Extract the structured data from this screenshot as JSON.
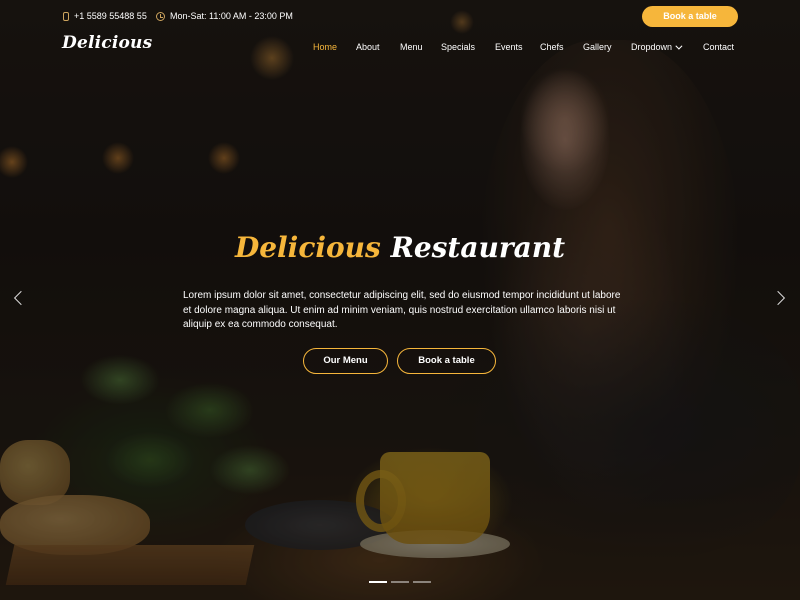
{
  "topbar": {
    "phone": "+1 5589 55488 55",
    "hours": "Mon-Sat: 11:00 AM - 23:00 PM",
    "book_button": "Book a table"
  },
  "header": {
    "logo": "Delicious",
    "nav": [
      {
        "label": "Home",
        "active": true
      },
      {
        "label": "About"
      },
      {
        "label": "Menu"
      },
      {
        "label": "Specials"
      },
      {
        "label": "Events"
      },
      {
        "label": "Chefs"
      },
      {
        "label": "Gallery"
      },
      {
        "label": "Dropdown"
      },
      {
        "label": "Contact"
      }
    ]
  },
  "hero": {
    "title_accent": "Delicious",
    "title_rest": "Restaurant",
    "description": "Lorem ipsum dolor sit amet, consectetur adipiscing elit, sed do eiusmod tempor incididunt ut labore et dolore magna aliqua. Ut enim ad minim veniam, quis nostrud exercitation ullamco laboris nisi ut aliquip ex ea commodo consequat.",
    "menu_button": "Our Menu",
    "book_button": "Book a table"
  },
  "carousel": {
    "slides": 3,
    "active_slide": 1
  },
  "colors": {
    "accent": "#f6b63b",
    "text": "#ffffff",
    "icon_accent": "#cda45e"
  },
  "icons": {
    "phone": "phone-icon",
    "clock": "clock-icon",
    "prev": "chevron-left-icon",
    "next": "chevron-right-icon",
    "dropdown": "chevron-down-icon"
  }
}
